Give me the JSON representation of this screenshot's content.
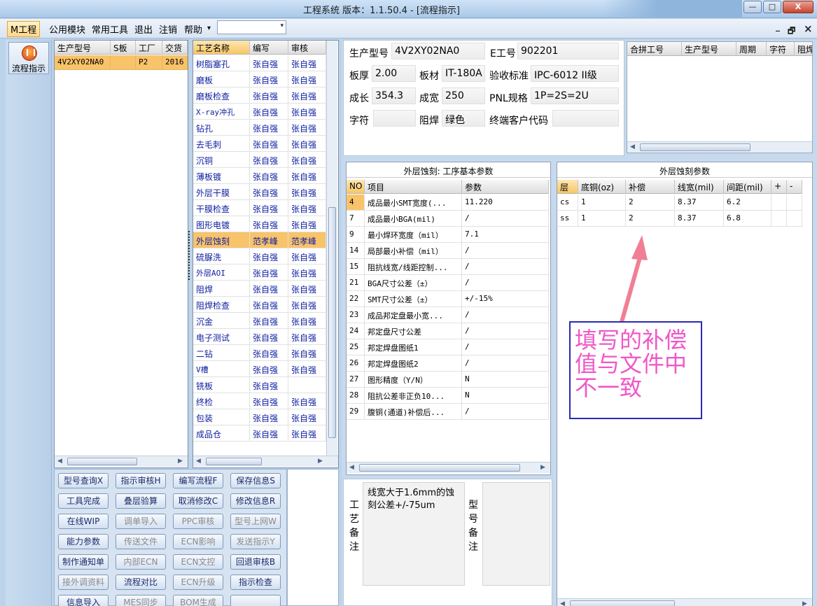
{
  "window": {
    "title": "工程系统  版本：1.1.50.4 - [流程指示]",
    "min_label": "—",
    "max_label": "□",
    "close_label": "X"
  },
  "menu": {
    "items": [
      "M工程",
      "公用模块",
      "常用工具",
      "退出",
      "注销",
      "帮助"
    ],
    "help_arrow": "▾",
    "combo_arrow": "▾",
    "mdi_min": "_",
    "mdi_restore": "🗗",
    "mdi_close": "×"
  },
  "nav": {
    "flow_button": "流程指示"
  },
  "model_grid": {
    "headers": [
      "生产型号",
      "S板",
      "工厂",
      "交货"
    ],
    "rows": [
      [
        "4V2XY02NA0",
        "",
        "P2",
        "2016"
      ]
    ]
  },
  "process_grid": {
    "headers": [
      "工艺名称",
      "编写",
      "审核"
    ],
    "rows": [
      [
        "树脂塞孔",
        "张自强",
        "张自强"
      ],
      [
        "磨板",
        "张自强",
        "张自强"
      ],
      [
        "磨板检查",
        "张自强",
        "张自强"
      ],
      [
        "X-ray冲孔",
        "张自强",
        "张自强"
      ],
      [
        "钻孔",
        "张自强",
        "张自强"
      ],
      [
        "去毛刺",
        "张自强",
        "张自强"
      ],
      [
        "沉铜",
        "张自强",
        "张自强"
      ],
      [
        "薄板镀",
        "张自强",
        "张自强"
      ],
      [
        "外层干膜",
        "张自强",
        "张自强"
      ],
      [
        "干膜检查",
        "张自强",
        "张自强"
      ],
      [
        "图形电镀",
        "张自强",
        "张自强"
      ],
      [
        "外层蚀刻",
        "范孝峰",
        "范孝峰"
      ],
      [
        "硫脲洗",
        "张自强",
        "张自强"
      ],
      [
        "外层AOI",
        "张自强",
        "张自强"
      ],
      [
        "阻焊",
        "张自强",
        "张自强"
      ],
      [
        "阻焊检查",
        "张自强",
        "张自强"
      ],
      [
        "沉金",
        "张自强",
        "张自强"
      ],
      [
        "电子测试",
        "张自强",
        "张自强"
      ],
      [
        "二钻",
        "张自强",
        "张自强"
      ],
      [
        "V槽",
        "张自强",
        "张自强"
      ],
      [
        "铣板",
        "张自强",
        ""
      ],
      [
        "终检",
        "张自强",
        "张自强"
      ],
      [
        "包装",
        "张自强",
        "张自强"
      ],
      [
        "成品仓",
        "张自强",
        "张自强"
      ]
    ],
    "selected_index": 11
  },
  "buttons": [
    [
      "型号查询X",
      "指示审核H",
      "编写流程F",
      "保存信息S"
    ],
    [
      "工具完成",
      "叠层验算",
      "取消修改C",
      "修改信息R"
    ],
    [
      "在线WIP",
      "调单导入",
      "PPC审核",
      "型号上网W"
    ],
    [
      "能力参数",
      "传送文件",
      "ECN影响",
      "发送指示Y"
    ],
    [
      "制作通知单",
      "内部ECN",
      "ECN文控",
      "回退审核B"
    ],
    [
      "接外调资料",
      "流程对比",
      "ECN升级",
      "指示检查"
    ],
    [
      "信息导入",
      "MES同步",
      "BOM生成",
      ""
    ]
  ],
  "buttons_disabled": [
    [
      false,
      false,
      false,
      false
    ],
    [
      false,
      false,
      false,
      false
    ],
    [
      false,
      true,
      true,
      true
    ],
    [
      false,
      true,
      true,
      true
    ],
    [
      false,
      true,
      true,
      false
    ],
    [
      true,
      false,
      true,
      false
    ],
    [
      false,
      true,
      true,
      false
    ]
  ],
  "info": {
    "model_label": "生产型号",
    "model_value": "4V2XY02NA0",
    "eno_label": "E工号",
    "eno_value": "902201",
    "thick_label": "板厚",
    "thick_value": "2.00",
    "material_label": "板材",
    "material_value": "IT-180A",
    "standard_label": "验收标准",
    "standard_value": "IPC-6012 II级",
    "length_label": "成长",
    "length_value": "354.3",
    "width_label": "成宽",
    "width_value": "250",
    "pnl_label": "PNL规格",
    "pnl_value": "1P=2S=2U",
    "char_label": "字符",
    "char_value": "",
    "mask_label": "阻焊",
    "mask_value": "绿色",
    "customer_label": "终端客户代码",
    "customer_value": ""
  },
  "combo_grid": {
    "headers": [
      "合拼工号",
      "生产型号",
      "周期",
      "字符",
      "阻焊"
    ]
  },
  "basic_params": {
    "title": "外层蚀刻: 工序基本参数",
    "headers": [
      "NO",
      "项目",
      "参数"
    ],
    "rows": [
      [
        "4",
        "成品最小SMT宽度(...",
        "11.220"
      ],
      [
        "7",
        "成品最小BGA(mil)",
        "/"
      ],
      [
        "9",
        "最小焊环宽度（mil）",
        "7.1"
      ],
      [
        "14",
        "局部最小补偿（mil）",
        "/"
      ],
      [
        "15",
        "阻抗线宽/线距控制...",
        "/"
      ],
      [
        "21",
        "BGA尺寸公差（±）",
        "/"
      ],
      [
        "22",
        "SMT尺寸公差（±）",
        "+/-15%"
      ],
      [
        "23",
        "成品邦定盘最小宽...",
        "/"
      ],
      [
        "24",
        "邦定盘尺寸公差",
        "/"
      ],
      [
        "25",
        "邦定焊盘图纸1",
        "/"
      ],
      [
        "26",
        "邦定焊盘图纸2",
        "/"
      ],
      [
        "27",
        "图形精度（Y/N）",
        "N"
      ],
      [
        "28",
        "阻抗公差非正负10...",
        "N"
      ],
      [
        "29",
        "腹铜(通道)补偿后...",
        "/"
      ]
    ]
  },
  "etch_params": {
    "title": "外层蚀刻参数",
    "headers": [
      "层",
      "底铜(oz)",
      "补偿",
      "线宽(mil)",
      "间距(mil)",
      "+",
      "-"
    ],
    "rows": [
      [
        "cs",
        "1",
        "2",
        "8.37",
        "6.2"
      ],
      [
        "ss",
        "1",
        "2",
        "8.37",
        "6.8"
      ]
    ]
  },
  "notes": {
    "process_label": "工艺备注",
    "process_text": "线宽大于1.6mm的蚀刻公差+/-75um",
    "model_label": "型号备注",
    "model_text": ""
  },
  "annotation": {
    "text": "填写的补偿值与文件中不一致",
    "arrow_color": "#f07f96",
    "text_color": "#ef58c8",
    "border_color": "#2a2ab5"
  }
}
